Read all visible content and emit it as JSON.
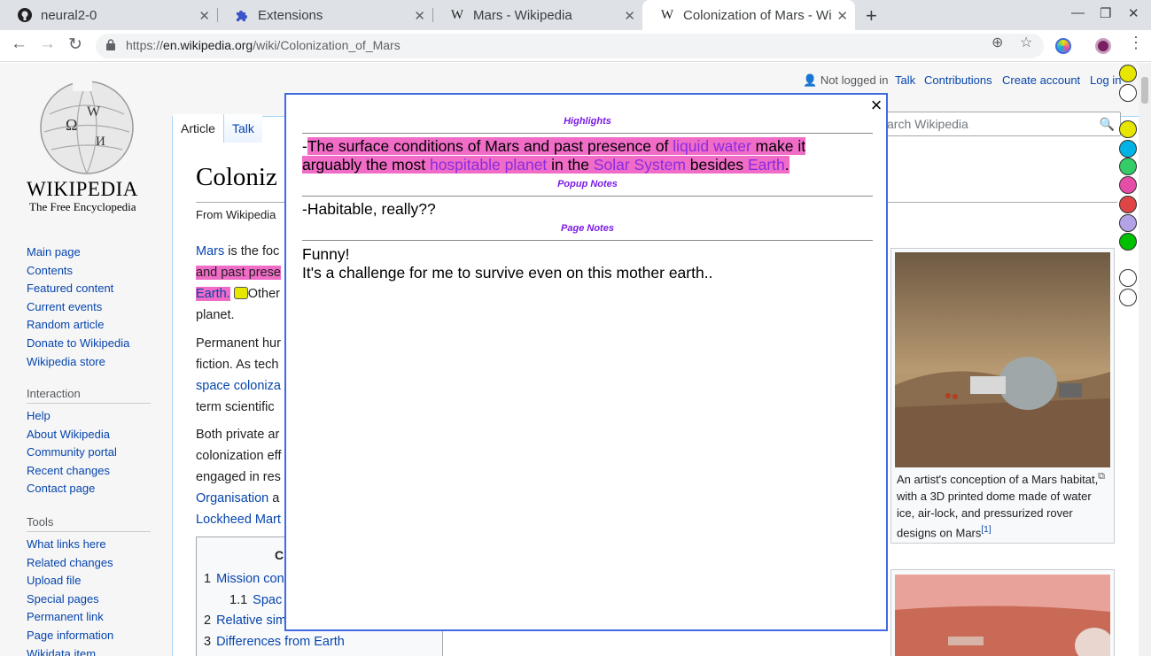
{
  "browser": {
    "tabs": [
      {
        "title": "neural2-0",
        "favicon": "github-icon"
      },
      {
        "title": "Extensions",
        "favicon": "puzzle-icon"
      },
      {
        "title": "Mars - Wikipedia",
        "favicon": "wikipedia-icon"
      },
      {
        "title": "Colonization of Mars - Wi",
        "favicon": "wikipedia-icon",
        "active": true
      }
    ],
    "new_tab": "+",
    "url_scheme": "https://",
    "url_host": "en.wikipedia.org",
    "url_path": "/wiki/Colonization_of_Mars"
  },
  "wiki": {
    "logo_word": "WIKIPEDIA",
    "logo_tagline": "The Free Encyclopedia",
    "nav_main": [
      "Main page",
      "Contents",
      "Featured content",
      "Current events",
      "Random article",
      "Donate to Wikipedia",
      "Wikipedia store"
    ],
    "interaction_heading": "Interaction",
    "nav_interaction": [
      "Help",
      "About Wikipedia",
      "Community portal",
      "Recent changes",
      "Contact page"
    ],
    "tools_heading": "Tools",
    "nav_tools": [
      "What links here",
      "Related changes",
      "Upload file",
      "Special pages",
      "Permanent link",
      "Page information",
      "Wikidata item"
    ],
    "page_tab_article": "Article",
    "page_tab_talk": "Talk",
    "not_logged_in": "Not logged in",
    "talk": "Talk",
    "contributions": "Contributions",
    "create_account": "Create account",
    "log_in": "Log in",
    "search_placeholder": "arch Wikipedia",
    "title": "Coloniz",
    "from": "From Wikipedia",
    "p1": {
      "l1_link": "Mars",
      "l1_text": " is the foc",
      "l2_hl": "and past prese",
      "l3_link": "Earth.",
      "l3_text": "Other",
      "l4": "planet."
    },
    "p2": {
      "l1": "Permanent hur",
      "l2": "fiction. As tech",
      "l3_link": "space coloniza",
      "l4": "term scientific"
    },
    "p3": {
      "l1": "Both private ar",
      "l2": "colonization eff",
      "l3": "engaged in res",
      "l4_link": "Organisation",
      "l4_text": " a",
      "l5_link": "Lockheed Mart"
    },
    "toc": {
      "title": "C",
      "items": [
        {
          "num": "1",
          "label": "Mission con"
        },
        {
          "num": "1.1",
          "label": "Spac"
        },
        {
          "num": "2",
          "label": "Relative sim"
        },
        {
          "num": "3",
          "label": "Differences from Earth"
        }
      ]
    },
    "infobox_caption": "An artist's conception of a Mars habitat, with a 3D printed dome made of water ice, air-lock, and pressurized rover designs on Mars",
    "infobox_ref": "[1]"
  },
  "popup": {
    "highlights_title": "Highlights",
    "highlight": {
      "prefix": "-",
      "t1": "The surface conditions of Mars and past presence of ",
      "link1": "liquid water",
      "t2": " make it",
      "t3": "arguably the most ",
      "link2": "hospitable planet",
      "t4": " in the ",
      "link3": "Solar System",
      "t5": " besides ",
      "link4": "Earth",
      "t6": "."
    },
    "popup_notes_title": "Popup Notes",
    "popup_note": "-Habitable, really??",
    "page_notes_title": "Page Notes",
    "page_note_line1": "Funny!",
    "page_note_line2": "It's a challenge for me to survive even on this mother earth..",
    "close": "×"
  },
  "extension_colors": [
    "#e6e600",
    "#00b3e6",
    "#33cc66",
    "#e64da6",
    "#e04545",
    "#b3a3e6",
    "#00c000"
  ],
  "highlight_color": "#f06cc7"
}
